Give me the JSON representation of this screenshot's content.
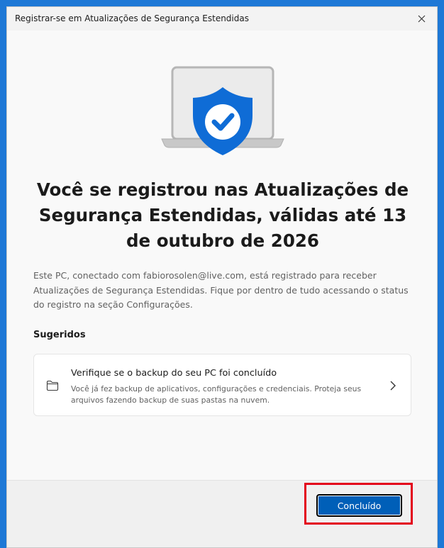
{
  "window": {
    "title": "Registrar-se em Atualizações de Segurança Estendidas"
  },
  "icons": {
    "close": "close-icon",
    "hero": "laptop-shield-check-icon",
    "card": "folder-icon",
    "card_chevron": "chevron-right-icon"
  },
  "main": {
    "heading": "Você se registrou nas Atualizações de Segurança Estendidas, válidas até 13 de outubro de 2026",
    "body": "Este PC, conectado com fabiorosolen@live.com, está registrado para receber Atualizações de Segurança Estendidas. Fique por dentro de tudo acessando o status do registro na seção Configurações.",
    "suggested_label": "Sugeridos",
    "card": {
      "title": "Verifique se o backup do seu PC foi concluído",
      "description": "Você já fez backup de aplicativos, configurações e credenciais. Proteja seus arquivos fazendo backup de suas pastas na nuvem."
    }
  },
  "footer": {
    "done_label": "Concluído"
  },
  "colors": {
    "accent": "#005fb8",
    "shield": "#0f6cd6",
    "highlight": "#e3001b",
    "desktop": "#1e78d6"
  }
}
